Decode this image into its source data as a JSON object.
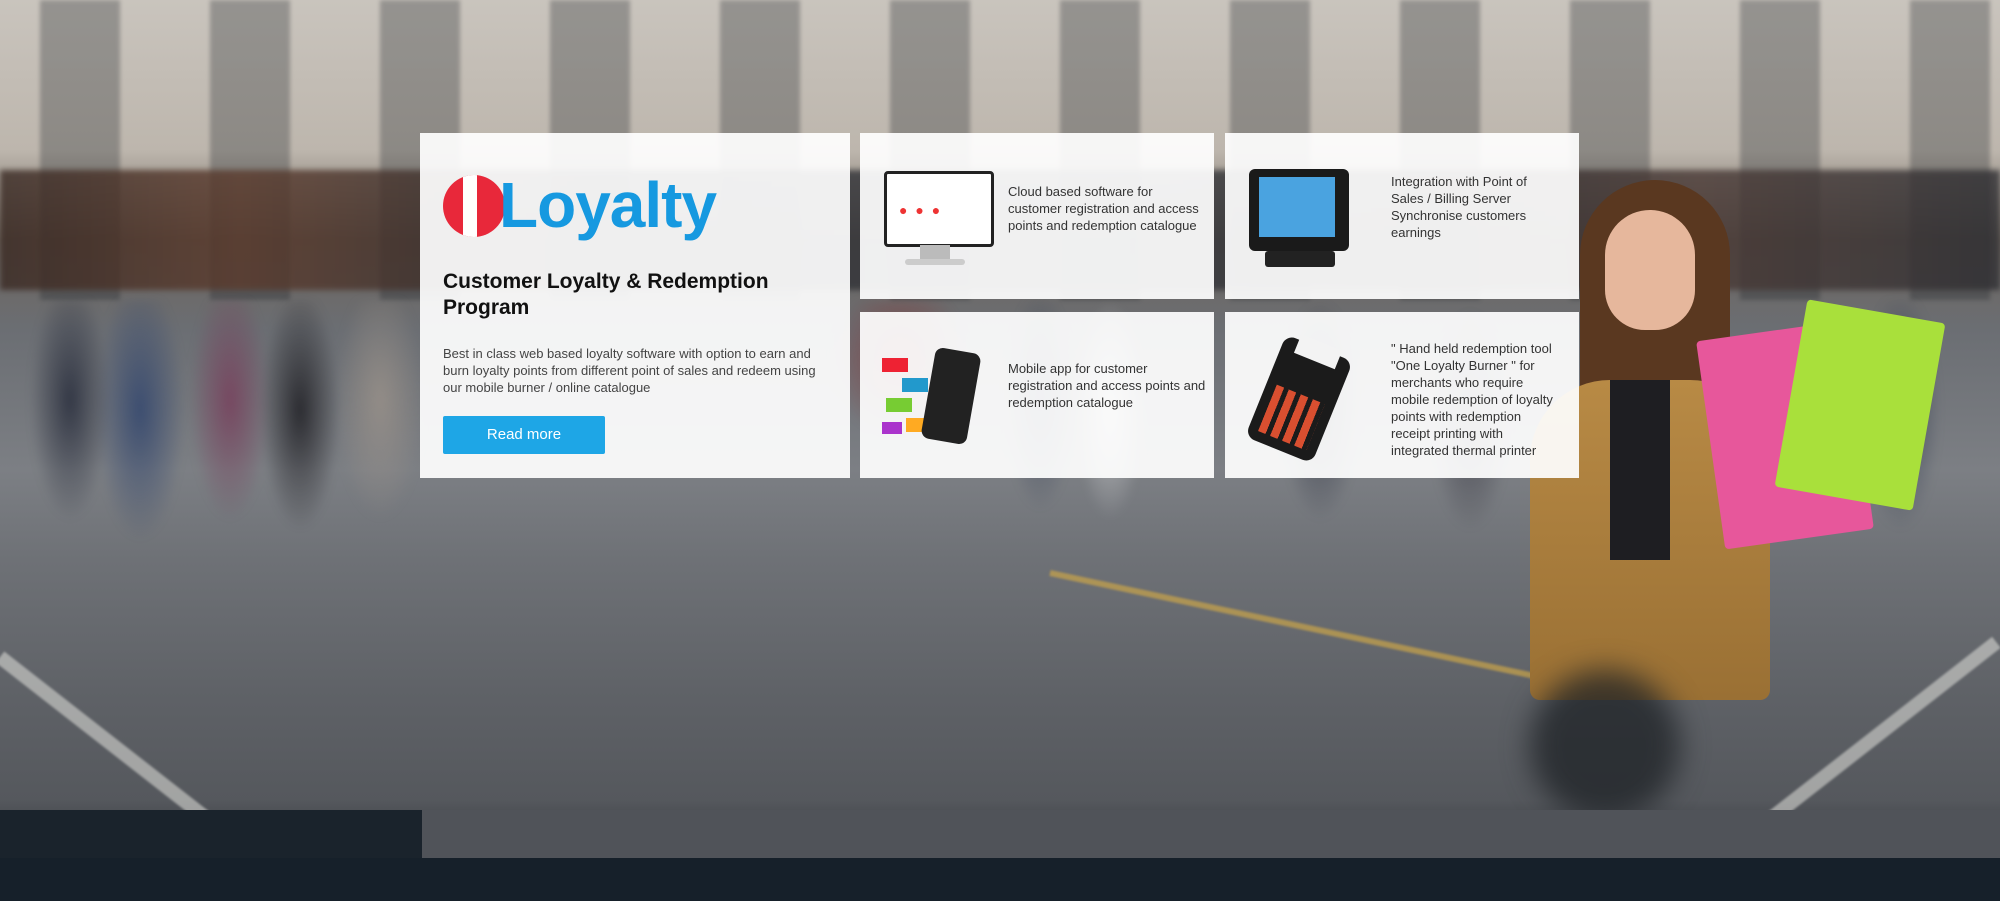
{
  "brand": {
    "logo_text": "Loyalty",
    "logo_color": "#1699e0",
    "logo_mark_color": "#e8283a"
  },
  "hero": {
    "title": "Customer Loyalty & Redemption Program",
    "description": "Best in class web based loyalty software with option to earn and burn loyalty points from different point of sales and redeem using our mobile burner / online catalogue",
    "read_more_label": "Read more",
    "button_color": "#1ea6e6"
  },
  "cards": [
    {
      "text": "Cloud based software for customer registration and access points and redemption catalogue",
      "icon": "monitor-icon"
    },
    {
      "text": "Integration with Point of Sales / Billing Server Synchronise customers earnings",
      "icon": "pos-terminal-icon"
    },
    {
      "text": "Mobile app for customer registration and access points and redemption catalogue",
      "icon": "mobile-app-icon"
    },
    {
      "text": "\" Hand held redemption tool \"One Loyalty Burner \" for merchants who require mobile redemption of loyalty points with redemption receipt printing with integrated thermal printer",
      "icon": "handheld-printer-icon"
    }
  ]
}
